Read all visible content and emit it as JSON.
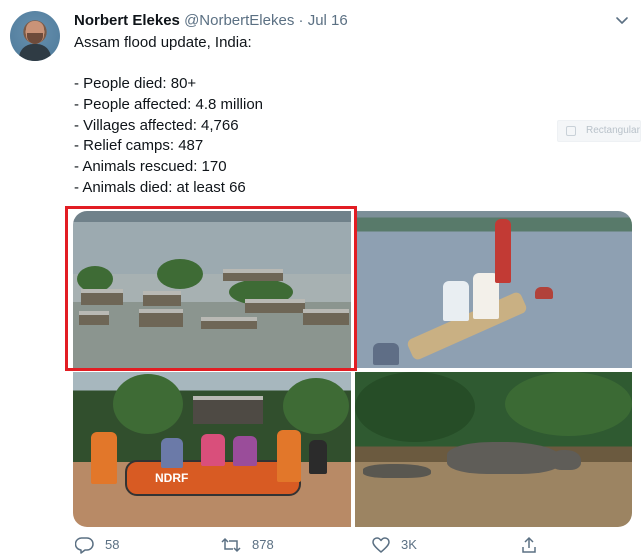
{
  "tweet": {
    "author_name": "Norbert Elekes",
    "handle": "@NorbertElekes",
    "separator": "·",
    "date": "Jul 16",
    "lines": [
      "Assam flood update, India:",
      "",
      "- People died: 80+",
      "- People affected: 4.8 million",
      "- Villages affected: 4,766",
      "- Relief camps: 487",
      "- Animals rescued: 170",
      "- Animals died: at least 66"
    ]
  },
  "overlay": {
    "ghost_label": "Rectangular"
  },
  "media": {
    "boat_label": "NDRF"
  },
  "actions": {
    "reply_count": "58",
    "retweet_count": "878",
    "like_count": "3K"
  },
  "colors": {
    "highlight": "#e21d23",
    "muted_text": "#5b7083"
  },
  "icons": {
    "reply": "reply-icon",
    "retweet": "retweet-icon",
    "like": "like-icon",
    "share": "share-icon",
    "caret": "chevron-down-icon"
  }
}
